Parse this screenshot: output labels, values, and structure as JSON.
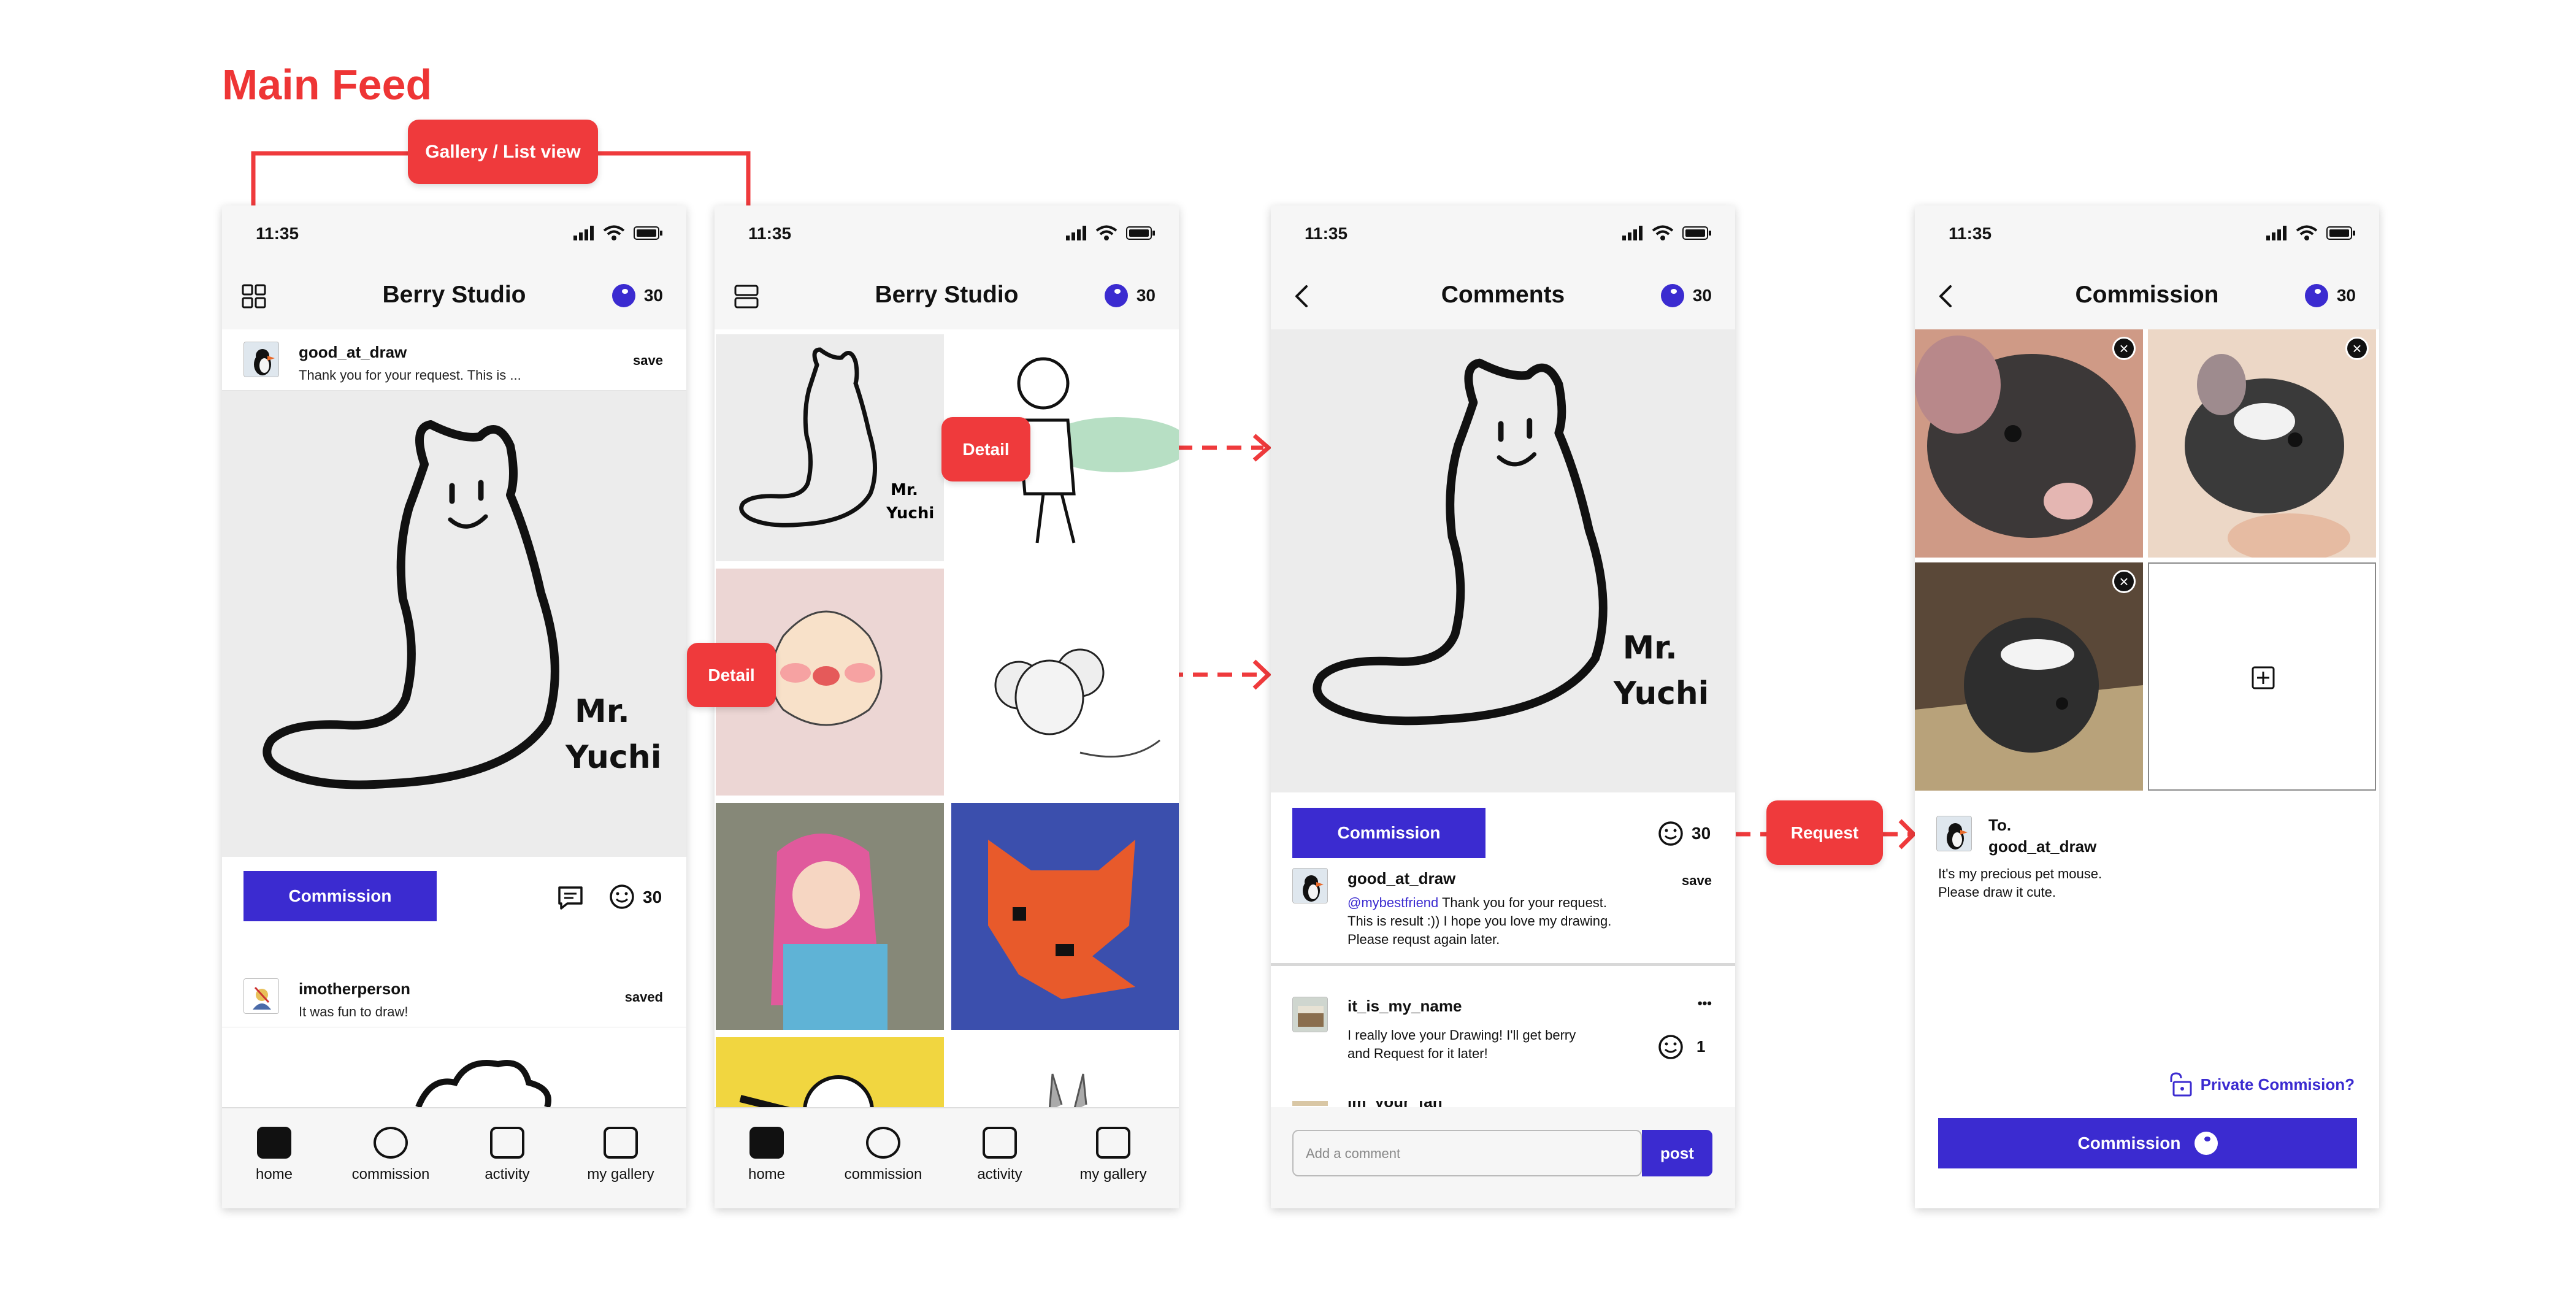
{
  "page_title": "Main Feed",
  "annotations": {
    "gallery_list_view": "Gallery / List view",
    "detail_1": "Detail",
    "detail_2": "Detail",
    "request": "Request"
  },
  "status": {
    "time": "11:35"
  },
  "app": {
    "name": "Berry Studio",
    "coins": "30"
  },
  "colors": {
    "accent": "#3b2bd0",
    "annotation": "#ef3a3c"
  },
  "tabs": [
    {
      "label": "home",
      "icon": "home-icon"
    },
    {
      "label": "commission",
      "icon": "commission-icon"
    },
    {
      "label": "activity",
      "icon": "activity-icon"
    },
    {
      "label": "my gallery",
      "icon": "profile-icon"
    }
  ],
  "feed": {
    "post1": {
      "user": "good_at_draw",
      "message": "Thank you for your request. This is ...",
      "action": "save",
      "art_text": "Mr.\nYuchi"
    },
    "commission_button": "Commission",
    "like_count": "30",
    "post2": {
      "user": "imotherperson",
      "message": "It was fun to draw!",
      "action": "saved"
    }
  },
  "comments_screen": {
    "title": "Comments",
    "commission_button": "Commission",
    "like_count": "30",
    "main_comment": {
      "user": "good_at_draw",
      "action": "save",
      "mention": "@mybestfriend",
      "line1": " Thank you for your request.",
      "line2": "This is result :)) I hope you love my drawing.",
      "line3": "Please requst again later."
    },
    "comment2": {
      "user": "it_is_my_name",
      "more": "•••",
      "line1": "I really love your Drawing! I'll get berry",
      "line2": "and Request for it later!",
      "likes": "1"
    },
    "comment3_user": "im_your_fan",
    "input_placeholder": "Add a comment",
    "post_button": "post"
  },
  "commission_screen": {
    "title": "Commission",
    "to_label": "To.",
    "to_user": "good_at_draw",
    "message_line1": "It's my precious pet mouse.",
    "message_line2": "Please draw it cute.",
    "private_label": "Private Commision?",
    "submit_button": "Commission",
    "add_icon": "plus-square-icon"
  }
}
